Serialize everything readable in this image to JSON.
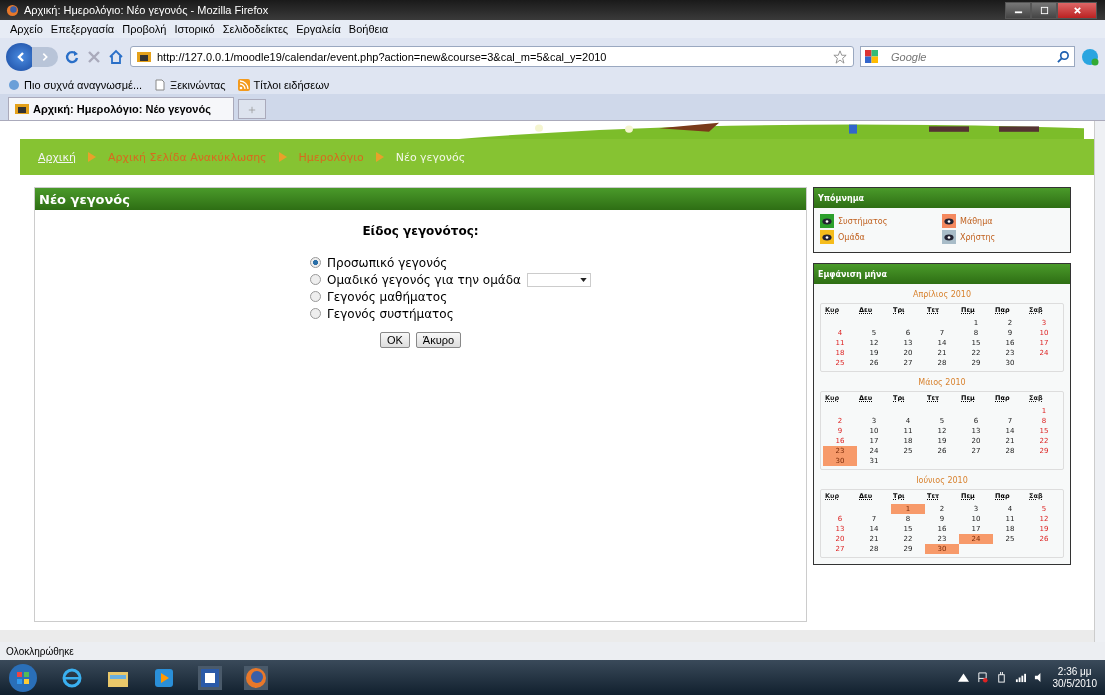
{
  "window": {
    "title": "Αρχική: Ημερολόγιο: Νέο γεγονός - Mozilla Firefox"
  },
  "menu": [
    "Αρχείο",
    "Επεξεργασία",
    "Προβολή",
    "Ιστορικό",
    "Σελιδοδείκτες",
    "Εργαλεία",
    "Βοήθεια"
  ],
  "address_bar": {
    "value": "http://127.0.0.1/moodle19/calendar/event.php?action=new&course=3&cal_m=5&cal_y=2010"
  },
  "search": {
    "placeholder": "Google"
  },
  "bookmarks": [
    {
      "label": "Πιο συχνά αναγνωσμέ...",
      "kind": "page"
    },
    {
      "label": "Ξεκινώντας",
      "kind": "doc"
    },
    {
      "label": "Τίτλοι ειδήσεων",
      "kind": "feed"
    }
  ],
  "tabs": [
    {
      "label": "Αρχική: Ημερολόγιο: Νέο γεγονός",
      "selected": true
    }
  ],
  "breadcrumb": [
    {
      "label": "Αρχική",
      "kind": "home"
    },
    {
      "label": "Αρχική Σελίδα Ανακύκλωσης",
      "kind": "link"
    },
    {
      "label": "Ημερολόγιο",
      "kind": "link"
    },
    {
      "label": "Νέο γεγονός",
      "kind": "current"
    }
  ],
  "main": {
    "title": "Νέο γεγονός",
    "heading": "Είδος γεγονότος:",
    "options": [
      {
        "label": "Προσωπικό γεγονός",
        "selected": true,
        "kind": "plain"
      },
      {
        "label": "Ομαδικό γεγονός για την ομάδα",
        "selected": false,
        "kind": "dropdown"
      },
      {
        "label": "Γεγονός μαθήματος",
        "selected": false,
        "kind": "plain"
      },
      {
        "label": "Γεγονός συστήματος",
        "selected": false,
        "kind": "plain"
      }
    ],
    "buttons": [
      "OK",
      "Άκυρο"
    ]
  },
  "legend": {
    "title": "Υπόμνημα",
    "items": [
      {
        "label": "Συστήματος",
        "color": "#2ca02c"
      },
      {
        "label": "Μάθημα",
        "color": "#f4895f"
      },
      {
        "label": "Ομάδα",
        "color": "#f5bc1c"
      },
      {
        "label": "Χρήστης",
        "color": "#a8bcc8"
      }
    ]
  },
  "calendar": {
    "title": "Εμφάνιση μήνα",
    "months": [
      {
        "title": "Απρίλιος 2010",
        "weekdays": [
          "Κυρ",
          "Δευ",
          "Τρι",
          "Τετ",
          "Πεμ",
          "Παρ",
          "Σαβ"
        ],
        "weeks": [
          {
            "kind": "lead",
            "days": [
              {
                "day": "1",
                "highlighted": false
              },
              {
                "day": "2",
                "highlighted": false
              },
              {
                "day": "3",
                "highlighted": false
              }
            ]
          },
          {
            "kind": "full",
            "days": [
              {
                "day": "4",
                "highlighted": false
              },
              {
                "day": "5",
                "highlighted": false
              },
              {
                "day": "6",
                "highlighted": false
              },
              {
                "day": "7",
                "highlighted": false
              },
              {
                "day": "8",
                "highlighted": false
              },
              {
                "day": "9",
                "highlighted": false
              },
              {
                "day": "10",
                "highlighted": false
              }
            ]
          },
          {
            "kind": "full",
            "days": [
              {
                "day": "11",
                "highlighted": false
              },
              {
                "day": "12",
                "highlighted": false
              },
              {
                "day": "13",
                "highlighted": false
              },
              {
                "day": "14",
                "highlighted": false
              },
              {
                "day": "15",
                "highlighted": false
              },
              {
                "day": "16",
                "highlighted": false
              },
              {
                "day": "17",
                "highlighted": false
              }
            ]
          },
          {
            "kind": "full",
            "days": [
              {
                "day": "18",
                "highlighted": false
              },
              {
                "day": "19",
                "highlighted": false
              },
              {
                "day": "20",
                "highlighted": false
              },
              {
                "day": "21",
                "highlighted": false
              },
              {
                "day": "22",
                "highlighted": false
              },
              {
                "day": "23",
                "highlighted": false
              },
              {
                "day": "24",
                "highlighted": false
              }
            ]
          },
          {
            "kind": "trail",
            "days": [
              {
                "day": "25",
                "highlighted": false
              },
              {
                "day": "26",
                "highlighted": false
              },
              {
                "day": "27",
                "highlighted": false
              },
              {
                "day": "28",
                "highlighted": false
              },
              {
                "day": "29",
                "highlighted": false
              },
              {
                "day": "30",
                "highlighted": false
              }
            ]
          }
        ]
      },
      {
        "title": "Μάιος 2010",
        "weekdays": [
          "Κυρ",
          "Δευ",
          "Τρι",
          "Τετ",
          "Πεμ",
          "Παρ",
          "Σαβ"
        ],
        "weeks": [
          {
            "kind": "lead",
            "days": [
              {
                "day": "1",
                "highlighted": false
              }
            ]
          },
          {
            "kind": "full",
            "days": [
              {
                "day": "2",
                "highlighted": false
              },
              {
                "day": "3",
                "highlighted": false
              },
              {
                "day": "4",
                "highlighted": false
              },
              {
                "day": "5",
                "highlighted": false
              },
              {
                "day": "6",
                "highlighted": false
              },
              {
                "day": "7",
                "highlighted": false
              },
              {
                "day": "8",
                "highlighted": false
              }
            ]
          },
          {
            "kind": "full",
            "days": [
              {
                "day": "9",
                "highlighted": false
              },
              {
                "day": "10",
                "highlighted": false
              },
              {
                "day": "11",
                "highlighted": false
              },
              {
                "day": "12",
                "highlighted": false
              },
              {
                "day": "13",
                "highlighted": false
              },
              {
                "day": "14",
                "highlighted": false
              },
              {
                "day": "15",
                "highlighted": false
              }
            ]
          },
          {
            "kind": "full",
            "days": [
              {
                "day": "16",
                "highlighted": false
              },
              {
                "day": "17",
                "highlighted": false
              },
              {
                "day": "18",
                "highlighted": false
              },
              {
                "day": "19",
                "highlighted": false
              },
              {
                "day": "20",
                "highlighted": false
              },
              {
                "day": "21",
                "highlighted": false
              },
              {
                "day": "22",
                "highlighted": false
              }
            ]
          },
          {
            "kind": "full",
            "days": [
              {
                "day": "23",
                "highlighted": true
              },
              {
                "day": "24",
                "highlighted": false
              },
              {
                "day": "25",
                "highlighted": false
              },
              {
                "day": "26",
                "highlighted": false
              },
              {
                "day": "27",
                "highlighted": false
              },
              {
                "day": "28",
                "highlighted": false
              },
              {
                "day": "29",
                "highlighted": false
              }
            ]
          },
          {
            "kind": "trail",
            "days": [
              {
                "day": "30",
                "highlighted": true
              },
              {
                "day": "31",
                "highlighted": false
              }
            ]
          }
        ]
      },
      {
        "title": "Ιούνιος 2010",
        "weekdays": [
          "Κυρ",
          "Δευ",
          "Τρι",
          "Τετ",
          "Πεμ",
          "Παρ",
          "Σαβ"
        ],
        "weeks": [
          {
            "kind": "lead",
            "days": [
              {
                "day": "1",
                "highlighted": true
              },
              {
                "day": "2",
                "highlighted": false
              },
              {
                "day": "3",
                "highlighted": false
              },
              {
                "day": "4",
                "highlighted": false
              },
              {
                "day": "5",
                "highlighted": false
              }
            ]
          },
          {
            "kind": "full",
            "days": [
              {
                "day": "6",
                "highlighted": false
              },
              {
                "day": "7",
                "highlighted": false
              },
              {
                "day": "8",
                "highlighted": false
              },
              {
                "day": "9",
                "highlighted": false
              },
              {
                "day": "10",
                "highlighted": false
              },
              {
                "day": "11",
                "highlighted": false
              },
              {
                "day": "12",
                "highlighted": false
              }
            ]
          },
          {
            "kind": "full",
            "days": [
              {
                "day": "13",
                "highlighted": false
              },
              {
                "day": "14",
                "highlighted": false
              },
              {
                "day": "15",
                "highlighted": false
              },
              {
                "day": "16",
                "highlighted": false
              },
              {
                "day": "17",
                "highlighted": false
              },
              {
                "day": "18",
                "highlighted": false
              },
              {
                "day": "19",
                "highlighted": false
              }
            ]
          },
          {
            "kind": "full",
            "days": [
              {
                "day": "20",
                "highlighted": false
              },
              {
                "day": "21",
                "highlighted": false
              },
              {
                "day": "22",
                "highlighted": false
              },
              {
                "day": "23",
                "highlighted": false
              },
              {
                "day": "24",
                "highlighted": true
              },
              {
                "day": "25",
                "highlighted": false
              },
              {
                "day": "26",
                "highlighted": false
              }
            ]
          },
          {
            "kind": "trail",
            "days": [
              {
                "day": "27",
                "highlighted": false
              },
              {
                "day": "28",
                "highlighted": false
              },
              {
                "day": "29",
                "highlighted": false
              },
              {
                "day": "30",
                "highlighted": true
              }
            ]
          }
        ]
      }
    ]
  },
  "status_bar": {
    "text": "Ολοκληρώθηκε"
  },
  "taskbar": {
    "time": "2:36 μμ",
    "date": "30/5/2010"
  }
}
